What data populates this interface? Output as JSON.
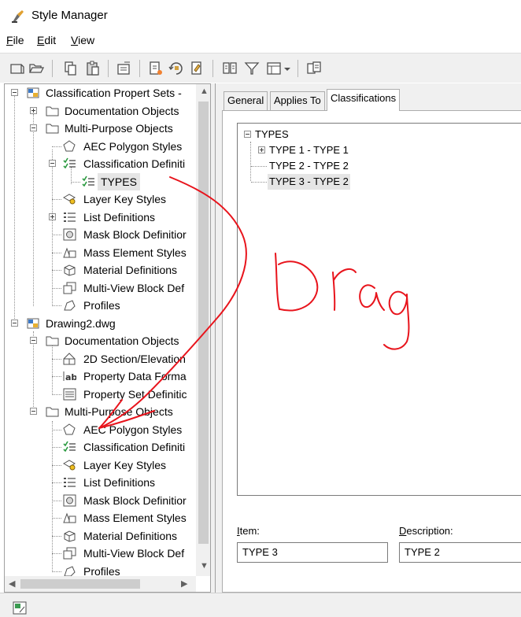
{
  "window": {
    "title": "Style Manager",
    "icon": "style-manager-icon"
  },
  "menu": [
    {
      "label": "File",
      "mnemonic": "F"
    },
    {
      "label": "Edit",
      "mnemonic": "E"
    },
    {
      "label": "View",
      "mnemonic": "V"
    }
  ],
  "toolbar": {
    "buttons": [
      "new-drawing-icon",
      "open-drawing-icon",
      "copy-icon",
      "paste-icon",
      "edit-style-icon",
      "new-style-icon",
      "set-from-icon",
      "purge-icon",
      "toggle-view-icon",
      "filter-icon",
      "view-mode-icon",
      "inline-edit-icon"
    ]
  },
  "tree": {
    "nodes": [
      {
        "label": "Classification Propert Sets -",
        "icon": "drawing-file-icon"
      },
      {
        "label": "Documentation Objects",
        "icon": "folder-icon"
      },
      {
        "label": "Multi-Purpose Objects",
        "icon": "folder-icon"
      },
      {
        "label": "AEC Polygon Styles",
        "icon": "polygon-icon"
      },
      {
        "label": "Classification Definiti",
        "icon": "classification-icon"
      },
      {
        "label": "TYPES",
        "icon": "classification-icon"
      },
      {
        "label": "Layer Key Styles",
        "icon": "layer-key-icon"
      },
      {
        "label": "List Definitions",
        "icon": "list-icon"
      },
      {
        "label": "Mask Block Definitior",
        "icon": "mask-block-icon"
      },
      {
        "label": "Mass Element Styles",
        "icon": "mass-element-icon"
      },
      {
        "label": "Material Definitions",
        "icon": "material-icon"
      },
      {
        "label": "Multi-View Block Def",
        "icon": "multi-view-block-icon"
      },
      {
        "label": "Profiles",
        "icon": "profile-icon"
      },
      {
        "label": "Drawing2.dwg",
        "icon": "drawing-file-icon"
      },
      {
        "label": "Documentation Objects",
        "icon": "folder-icon"
      },
      {
        "label": "2D Section/Elevation",
        "icon": "section-elevation-icon"
      },
      {
        "label": "Property Data Forma",
        "icon": "property-format-icon"
      },
      {
        "label": "Property Set Definitic",
        "icon": "property-set-icon"
      },
      {
        "label": "Multi-Purpose Objects",
        "icon": "folder-icon"
      },
      {
        "label": "AEC Polygon Styles",
        "icon": "polygon-icon"
      },
      {
        "label": "Classification Definiti",
        "icon": "classification-icon"
      },
      {
        "label": "Layer Key Styles",
        "icon": "layer-key-icon"
      },
      {
        "label": "List Definitions",
        "icon": "list-icon"
      },
      {
        "label": "Mask Block Definitior",
        "icon": "mask-block-icon"
      },
      {
        "label": "Mass Element Styles",
        "icon": "mass-element-icon"
      },
      {
        "label": "Material Definitions",
        "icon": "material-icon"
      },
      {
        "label": "Multi-View Block Def",
        "icon": "multi-view-block-icon"
      },
      {
        "label": "Profiles",
        "icon": "profile-icon"
      }
    ],
    "selected": "TYPES"
  },
  "tabs": [
    {
      "label": "General"
    },
    {
      "label": "Applies To"
    },
    {
      "label": "Classifications",
      "active": true
    }
  ],
  "classifications": {
    "root": "TYPES",
    "items": [
      "TYPE 1 - TYPE 1",
      "TYPE 2 - TYPE 2",
      "TYPE 3 - TYPE 2"
    ],
    "selected_item": "TYPE 3 - TYPE 2"
  },
  "fields": {
    "item_label": "Item:",
    "item_mnemonic": "I",
    "item_value": "TYPE 3",
    "description_label": "Description:",
    "description_mnemonic": "D",
    "description_value": "TYPE 2"
  },
  "annotation": {
    "text": "Drag",
    "color": "#e8141c"
  },
  "status": {
    "icon": "status-drawing-icon"
  }
}
